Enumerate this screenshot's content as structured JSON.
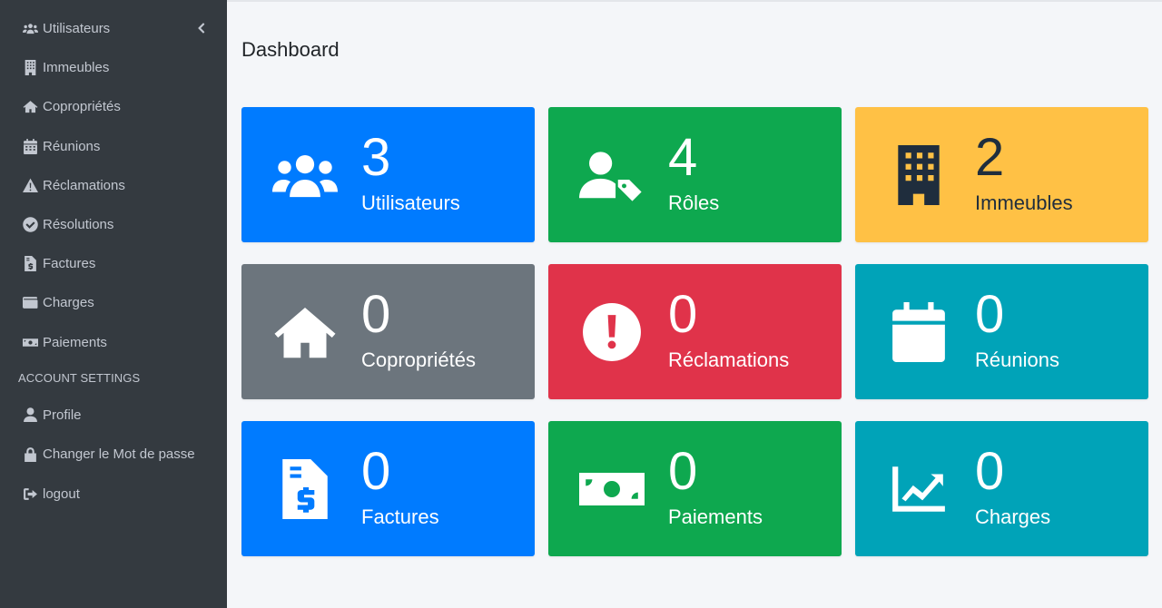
{
  "sidebar": {
    "items": [
      {
        "label": "Utilisateurs",
        "icon": "users-icon"
      },
      {
        "label": "Immeubles",
        "icon": "building-icon"
      },
      {
        "label": "Copropriétés",
        "icon": "home-icon"
      },
      {
        "label": "Réunions",
        "icon": "calendar-icon"
      },
      {
        "label": "Réclamations",
        "icon": "warning-icon"
      },
      {
        "label": "Résolutions",
        "icon": "check-circle-icon"
      },
      {
        "label": "Factures",
        "icon": "invoice-icon"
      },
      {
        "label": "Charges",
        "icon": "wallet-icon"
      },
      {
        "label": "Paiements",
        "icon": "money-bill-icon"
      }
    ],
    "section_header": "ACCOUNT SETTINGS",
    "account_items": [
      {
        "label": "Profile",
        "icon": "user-icon"
      },
      {
        "label": "Changer le Mot de passe",
        "icon": "lock-icon"
      },
      {
        "label": "logout",
        "icon": "sign-out-icon"
      }
    ]
  },
  "page": {
    "title": "Dashboard"
  },
  "cards": [
    {
      "value": "3",
      "label": "Utilisateurs",
      "icon": "users-icon",
      "color": "#007bff"
    },
    {
      "value": "4",
      "label": "Rôles",
      "icon": "user-tag-icon",
      "color": "#0ea84f"
    },
    {
      "value": "2",
      "label": "Immeubles",
      "icon": "building-icon",
      "color": "#ffc145"
    },
    {
      "value": "0",
      "label": "Copropriétés",
      "icon": "home-icon",
      "color": "#6c757d"
    },
    {
      "value": "0",
      "label": "Réclamations",
      "icon": "exclamation-circle-icon",
      "color": "#e0334a"
    },
    {
      "value": "0",
      "label": "Réunions",
      "icon": "calendar-icon",
      "color": "#00a3b8"
    },
    {
      "value": "0",
      "label": "Factures",
      "icon": "invoice-dollar-icon",
      "color": "#007bff"
    },
    {
      "value": "0",
      "label": "Paiements",
      "icon": "money-bill-icon",
      "color": "#0ea84f"
    },
    {
      "value": "0",
      "label": "Charges",
      "icon": "chart-line-icon",
      "color": "#00a3b8"
    }
  ]
}
